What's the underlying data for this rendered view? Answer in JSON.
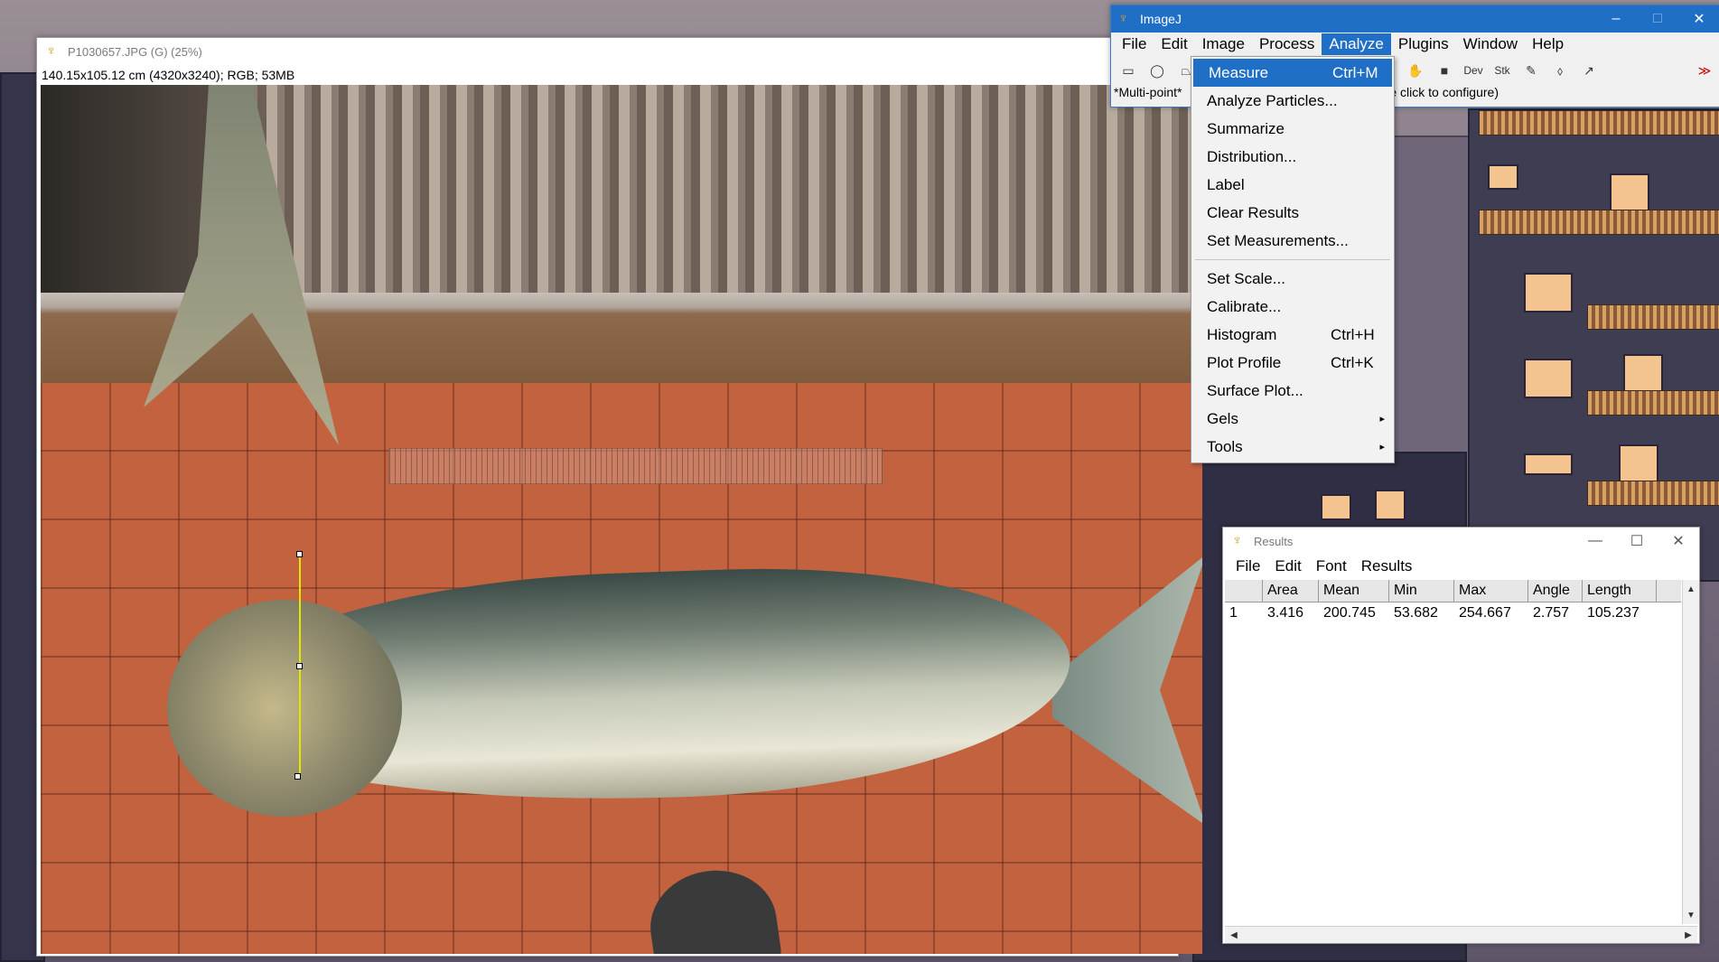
{
  "image_window": {
    "title": "P1030657.JPG (G) (25%)",
    "info": "140.15x105.12 cm (4320x3240); RGB; 53MB",
    "minimize": "—"
  },
  "imagej": {
    "title": "ImageJ",
    "menus": [
      "File",
      "Edit",
      "Image",
      "Process",
      "Analyze",
      "Plugins",
      "Window",
      "Help"
    ],
    "active_menu": "Analyze",
    "tools": {
      "rectangle": "▭",
      "oval": "◯",
      "polygon": "⏢",
      "magnifier": "🔍",
      "hand": "✋",
      "color": "■",
      "dev": "Dev",
      "stk": "Stk",
      "brush": "✎",
      "drop": "⬨",
      "pick": "↗",
      "more": "≫"
    },
    "status_left": "*Multi-point*",
    "status_right": "ble click to configure)",
    "minimize": "–",
    "maximize": "□",
    "close": "✕"
  },
  "analyze_menu": {
    "items": [
      {
        "label": "Measure",
        "shortcut": "Ctrl+M"
      },
      {
        "label": "Analyze Particles...",
        "shortcut": ""
      },
      {
        "label": "Summarize",
        "shortcut": ""
      },
      {
        "label": "Distribution...",
        "shortcut": ""
      },
      {
        "label": "Label",
        "shortcut": ""
      },
      {
        "label": "Clear Results",
        "shortcut": ""
      },
      {
        "label": "Set Measurements...",
        "shortcut": ""
      }
    ],
    "items2": [
      {
        "label": "Set Scale...",
        "shortcut": ""
      },
      {
        "label": "Calibrate...",
        "shortcut": ""
      },
      {
        "label": "Histogram",
        "shortcut": "Ctrl+H"
      },
      {
        "label": "Plot Profile",
        "shortcut": "Ctrl+K"
      },
      {
        "label": "Surface Plot...",
        "shortcut": ""
      },
      {
        "label": "Gels",
        "shortcut": ""
      },
      {
        "label": "Tools",
        "shortcut": ""
      }
    ],
    "submenu_arrow": "▸"
  },
  "results": {
    "title": "Results",
    "menus": [
      "File",
      "Edit",
      "Font",
      "Results"
    ],
    "columns": [
      "",
      "Area",
      "Mean",
      "Min",
      "Max",
      "Angle",
      "Length"
    ],
    "rows": [
      [
        "1",
        "3.416",
        "200.745",
        "53.682",
        "254.667",
        "2.757",
        "105.237"
      ]
    ],
    "minimize": "—",
    "maximize": "☐",
    "close": "✕",
    "scroll_up": "▲",
    "scroll_down": "▼",
    "scroll_left": "◀",
    "scroll_right": "▶"
  },
  "colors": {
    "accent": "#1f6fc6",
    "measure_line": "#e6e600"
  },
  "icons": {
    "app_icon": "microscope-icon"
  }
}
